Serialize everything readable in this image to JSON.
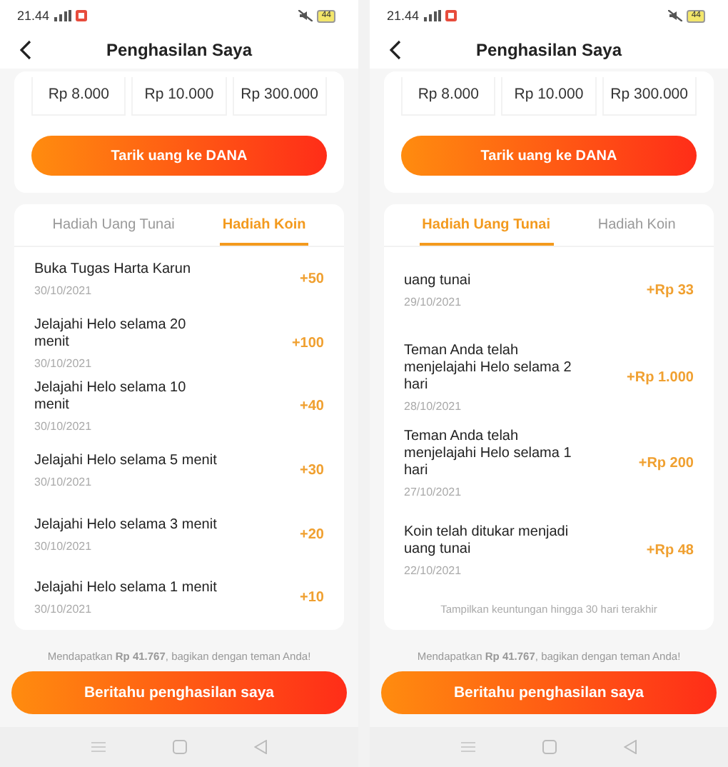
{
  "screens": [
    {
      "status_bar": {
        "time": "21.44",
        "battery": "44"
      },
      "header": {
        "title": "Penghasilan Saya"
      },
      "amounts": [
        "Rp 8.000",
        "Rp 10.000",
        "Rp 300.000"
      ],
      "withdraw_button": "Tarik uang ke DANA",
      "tabs": [
        {
          "label": "Hadiah Uang Tunai",
          "selected": false
        },
        {
          "label": "Hadiah Koin",
          "selected": true
        }
      ],
      "items": [
        {
          "title": "Buka Tugas Harta Karun",
          "date": "30/10/2021",
          "amount": "+50"
        },
        {
          "title": "Jelajahi Helo selama 20 menit",
          "date": "30/10/2021",
          "amount": "+100"
        },
        {
          "title": "Jelajahi Helo selama 10 menit",
          "date": "30/10/2021",
          "amount": "+40"
        },
        {
          "title": "Jelajahi Helo selama 5 menit",
          "date": "30/10/2021",
          "amount": "+30"
        },
        {
          "title": "Jelajahi Helo selama 3 menit",
          "date": "30/10/2021",
          "amount": "+20"
        },
        {
          "title": "Jelajahi Helo selama 1 menit",
          "date": "30/10/2021",
          "amount": "+10"
        }
      ],
      "share_text": "Mendapatkan **Rp 41.767**, bagikan dengan teman Anda!",
      "share_button": "Beritahu penghasilan saya"
    },
    {
      "status_bar": {
        "time": "21.44",
        "battery": "44"
      },
      "header": {
        "title": "Penghasilan Saya"
      },
      "amounts": [
        "Rp 8.000",
        "Rp 10.000",
        "Rp 300.000"
      ],
      "withdraw_button": "Tarik uang ke DANA",
      "tabs": [
        {
          "label": "Hadiah Uang Tunai",
          "selected": true
        },
        {
          "label": "Hadiah Koin",
          "selected": false
        }
      ],
      "items": [
        {
          "title": "uang tunai",
          "date": "29/10/2021",
          "amount": "+Rp 33"
        },
        {
          "title": "Teman Anda telah menjelajahi Helo selama 2 hari",
          "date": "28/10/2021",
          "amount": "+Rp 1.000"
        },
        {
          "title": "Teman Anda telah menjelajahi Helo selama 1 hari",
          "date": "27/10/2021",
          "amount": "+Rp 200"
        },
        {
          "title": "Koin telah ditukar menjadi uang tunai",
          "date": "22/10/2021",
          "amount": "+Rp 48"
        }
      ],
      "list_note": "Tampilkan keuntungan hingga 30 hari terakhir",
      "share_text": "Mendapatkan **Rp 41.767**, bagikan dengan teman Anda!",
      "share_button": "Beritahu penghasilan saya"
    }
  ]
}
